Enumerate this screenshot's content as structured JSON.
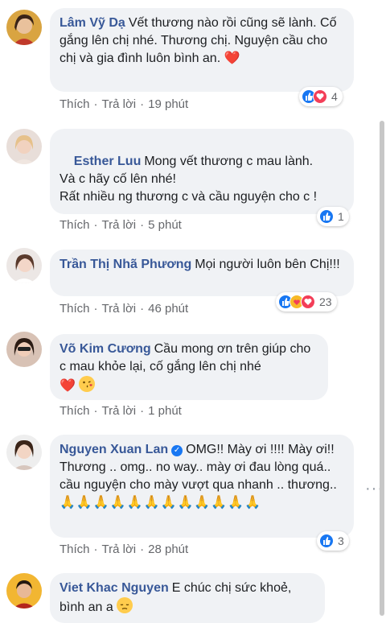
{
  "comments": [
    {
      "author": "Lâm Vỹ Dạ",
      "text": "Vết thương nào rồi cũng sẽ lành. Cố gắng lên chị nhé. Thương chị. Nguyện cầu cho chị và gia đình luôn bình an.",
      "like": "Thích",
      "reply": "Trả lời",
      "time": "19 phút",
      "reaction_count": "4",
      "reactions": [
        "like-icon",
        "love-icon"
      ]
    },
    {
      "author": "Esther Luu",
      "text": "Mong vết thương c mau lành.\nVà c hãy cố lên nhé!\nRất nhiều ng thương c và cầu nguyện cho c !",
      "like": "Thích",
      "reply": "Trả lời",
      "time": "5 phút",
      "reaction_count": "1",
      "reactions": [
        "like-icon"
      ]
    },
    {
      "author": "Trần Thị Nhã Phương",
      "text": "Mọi người luôn bên Chị!!!",
      "like": "Thích",
      "reply": "Trả lời",
      "time": "46 phút",
      "reaction_count": "23",
      "reactions": [
        "like-icon",
        "care-icon",
        "love-icon"
      ]
    },
    {
      "author": "Võ Kim Cương",
      "text": "Cầu mong ơn trên giúp cho c mau khỏe lại, cố gắng lên chị nhé",
      "like": "Thích",
      "reply": "Trả lời",
      "time": "1 phút"
    },
    {
      "author": "Nguyen Xuan Lan",
      "text": "OMG!! Mày ơi !!!! Mày ơi!! Thương .. omg.. no way.. mày ơi đau lòng quá.. cầu nguyện cho mày vượt qua nhanh .. thương..",
      "like": "Thích",
      "reply": "Trả lời",
      "time": "28 phút",
      "reaction_count": "3",
      "reactions": [
        "like-icon"
      ]
    },
    {
      "author": "Viet Khac Nguyen",
      "text": "E chúc chị sức khoẻ, bình an a"
    }
  ],
  "colors": {
    "link_blue": "#385898",
    "bubble_bg": "#f0f2f5",
    "meta_gray": "#65676b",
    "like_blue": "#1877f2",
    "love_red": "#f33e58"
  }
}
